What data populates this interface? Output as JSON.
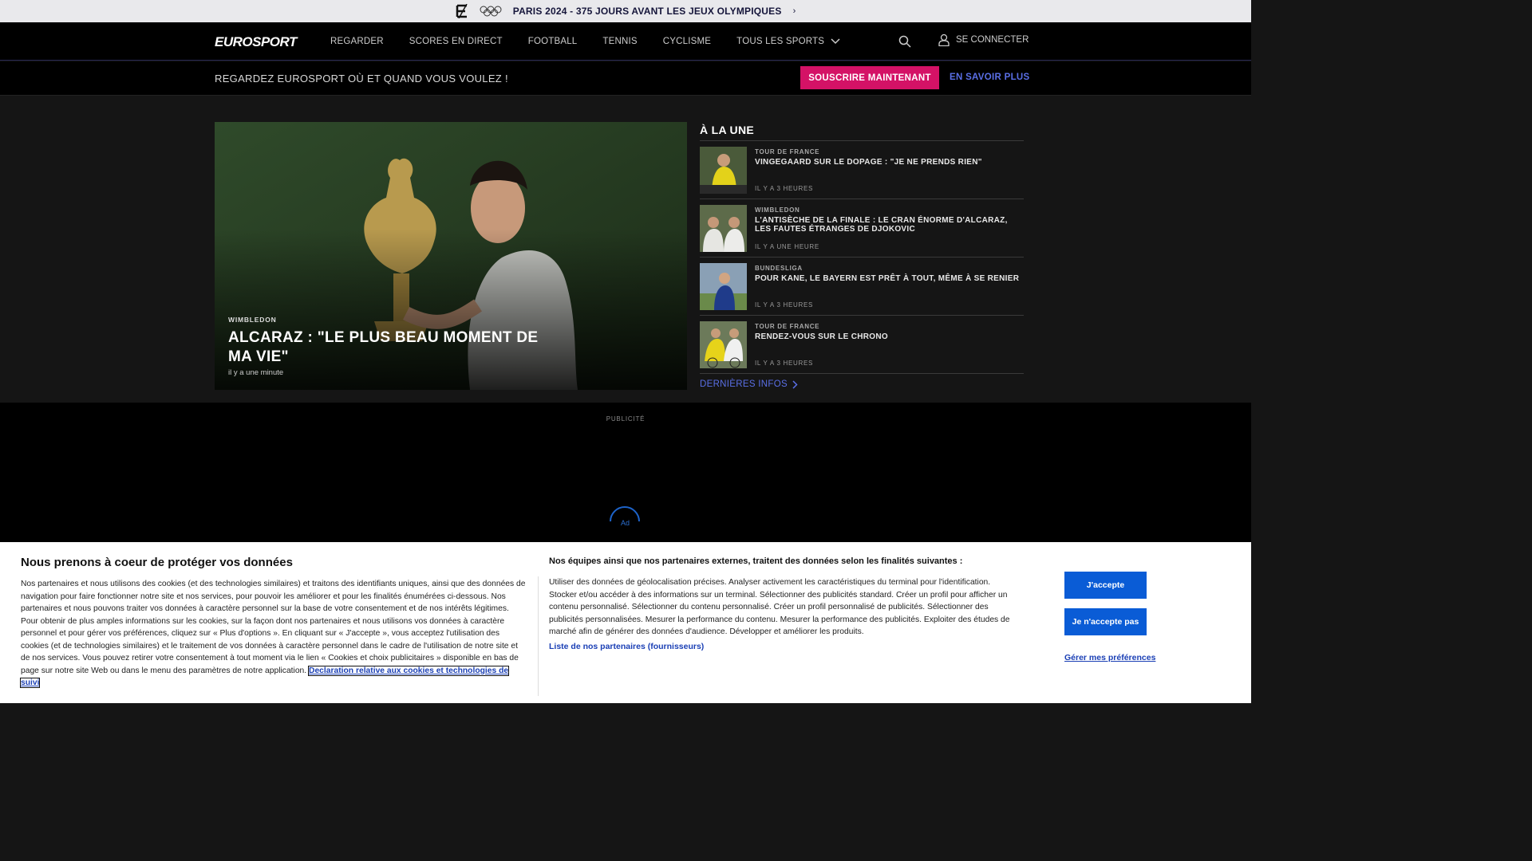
{
  "promo_bar": {
    "text": "PARIS 2024 - 375 JOURS AVANT LES JEUX OLYMPIQUES",
    "chevron": "›",
    "rings": "OOO"
  },
  "nav": {
    "brand": "EUROSPORT",
    "items": [
      {
        "label": "REGARDER"
      },
      {
        "label": "SCORES EN DIRECT"
      },
      {
        "label": "FOOTBALL"
      },
      {
        "label": "TENNIS"
      },
      {
        "label": "CYCLISME"
      },
      {
        "label": "TOUS LES SPORTS"
      }
    ],
    "login_label": "SE CONNECTER"
  },
  "subscribe_bar": {
    "tagline": "REGARDEZ EUROSPORT OÙ ET QUAND VOUS VOULEZ !",
    "subscribe_label": "SOUSCRIRE MAINTENANT",
    "learn_more_label": "EN SAVOIR PLUS"
  },
  "hero": {
    "category": "WIMBLEDON",
    "headline": "ALCARAZ : \"LE PLUS BEAU MOMENT DE MA VIE\"",
    "time": "il y a une minute"
  },
  "top_stories": {
    "heading": "À LA UNE",
    "items": [
      {
        "category": "TOUR DE FRANCE",
        "title": "VINGEGAARD SUR LE DOPAGE : \"JE NE PRENDS RIEN\"",
        "time": "IL Y A 3 HEURES"
      },
      {
        "category": "WIMBLEDON",
        "title": "L'ANTISÈCHE DE LA FINALE : LE CRAN ÉNORME D'ALCARAZ, LES FAUTES ÉTRANGES DE DJOKOVIC",
        "time": "IL Y A UNE HEURE"
      },
      {
        "category": "BUNDESLIGA",
        "title": "POUR KANE, LE BAYERN EST PRÊT À TOUT, MÊME À SE RENIER",
        "time": "IL Y A 3 HEURES"
      },
      {
        "category": "TOUR DE FRANCE",
        "title": "RENDEZ-VOUS SUR LE CHRONO",
        "time": "IL Y A 3 HEURES"
      }
    ],
    "more_label": "DERNIÈRES INFOS"
  },
  "ad": {
    "label": "PUBLICITÉ",
    "placeholder": "Ad"
  },
  "cookie_banner": {
    "title": "Nous prenons à coeur de protéger vos données",
    "body": "Nos partenaires et nous utilisons des cookies (et des technologies similaires) et traitons des identifiants uniques, ainsi que des données de navigation pour faire fonctionner notre site et nos services, pour pouvoir les améliorer et pour les finalités énumérées ci-dessous. Nos partenaires et nous pouvons traiter vos données à caractère personnel sur la base de votre consentement et de nos intérêts légitimes. Pour obtenir de plus amples informations sur les cookies, sur la façon dont nos partenaires et nous utilisons vos données à caractère personnel et pour gérer vos préférences, cliquez sur « Plus d'options ». En cliquant sur « J'accepte », vous acceptez l'utilisation des cookies (et de technologies similaires) et le traitement de vos données à caractère personnel dans le cadre de l'utilisation de notre site et de nos services. Vous pouvez retirer votre consentement à tout moment via le lien « Cookies et choix publicitaires » disponible en bas de page sur notre site Web ou dans le menu des paramètres de notre application.",
    "policy_link": "Declaration relative aux cookies et technologies de suivi",
    "purposes_title": "Nos équipes ainsi que nos partenaires externes, traitent des données selon les finalités suivantes :",
    "purposes_body": "Utiliser des données de géolocalisation précises. Analyser activement les caractéristiques du terminal pour l'identification. Stocker et/ou accéder à des informations sur un terminal. Sélectionner des publicités standard. Créer un profil pour afficher un contenu personnalisé. Sélectionner du contenu personnalisé. Créer un profil personnalisé de publicités. Sélectionner des publicités personnalisées. Mesurer la performance du contenu. Mesurer la performance des publicités. Exploiter des études de marché afin de générer des données d'audience. Développer et améliorer les produits.",
    "partners_link": "Liste de nos partenaires (fournisseurs)",
    "accept_label": "J'accepte",
    "reject_label": "Je n'accepte pas",
    "prefs_label": "Gérer mes préférences"
  },
  "colors": {
    "accent_pink": "#d41266",
    "link_blue": "#5a6fe6",
    "cookie_button_blue": "#0a5cd6"
  }
}
